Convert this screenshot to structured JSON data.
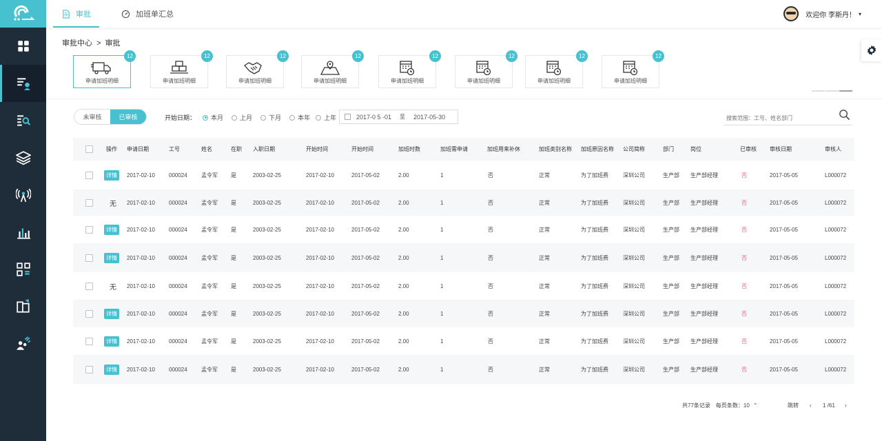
{
  "topbar": {
    "tabs": [
      {
        "label": "审批",
        "icon": "document-icon",
        "active": true
      },
      {
        "label": "加班单汇总",
        "icon": "dashboard-icon",
        "active": false
      }
    ],
    "user_greeting": "欢迎你  李斯丹！",
    "user_caret": "▾"
  },
  "sidebar": {
    "items": [
      {
        "icon": "grid-icon",
        "active": false
      },
      {
        "icon": "approval-list-icon",
        "active": true
      },
      {
        "icon": "search-list-icon",
        "active": false
      },
      {
        "icon": "layers-icon",
        "active": false
      },
      {
        "icon": "broadcast-icon",
        "active": false
      },
      {
        "icon": "bar-chart-icon",
        "active": false
      },
      {
        "icon": "qr-code-icon",
        "active": false
      },
      {
        "icon": "book-icon",
        "active": false
      },
      {
        "icon": "team-growth-icon",
        "active": false
      }
    ]
  },
  "breadcrumb": {
    "root": "审批中心",
    "sep": ">",
    "current": "审批"
  },
  "cards": [
    {
      "label": "申请加班明细",
      "badge": "12",
      "icon": "truck-icon",
      "active": true
    },
    {
      "label": "申请加班明细",
      "badge": "12",
      "icon": "cargo-icon",
      "active": false
    },
    {
      "label": "申请加班明细",
      "badge": "12",
      "icon": "handshake-icon",
      "active": false
    },
    {
      "label": "申请加班明细",
      "badge": "12",
      "icon": "map-pin-icon",
      "active": false
    },
    {
      "label": "申请加班明细",
      "badge": "12",
      "icon": "calendar-clock-icon",
      "active": false
    },
    {
      "label": "申请加班明细",
      "badge": "12",
      "icon": "calendar-clock-icon",
      "active": false
    },
    {
      "label": "申请加班明细",
      "badge": "12",
      "icon": "calendar-clock-icon",
      "active": false
    },
    {
      "label": "申请加班明细",
      "badge": "12",
      "icon": "calendar-clock-icon",
      "active": false
    }
  ],
  "filter": {
    "status_tabs": [
      {
        "label": "未审核",
        "active": false
      },
      {
        "label": "已审核",
        "active": true
      }
    ],
    "date_label": "开始日期：",
    "radios": [
      {
        "label": "本月",
        "checked": true
      },
      {
        "label": "上月",
        "checked": false
      },
      {
        "label": "下月",
        "checked": false
      },
      {
        "label": "本年",
        "checked": false
      },
      {
        "label": "上年",
        "checked": false
      }
    ],
    "range_start": "2017-0 5 -01",
    "range_to": "至",
    "range_end": "2017-05-30",
    "search_placeholder": "搜索范围：工号、姓名部门"
  },
  "table": {
    "columns": [
      "",
      "操作",
      "申请日期",
      "工号",
      "姓名",
      "在职",
      "入职日期",
      "开始时间",
      "开始时间",
      "加班时数",
      "加班需申请",
      "加班用来补休",
      "加班类别名称",
      "加班原因名称",
      "公司简称",
      "部门",
      "岗位",
      "已审核",
      "审核日期",
      "审核人"
    ],
    "rows": [
      {
        "op": "详情",
        "apply_date": "2017-02-10",
        "emp_no": "000024",
        "name": "孟令军",
        "employed": "是",
        "hire_date": "2003-02-25",
        "start1": "2017-02-10",
        "start2": "2017-05-02",
        "hours": "2.00",
        "need_apply": "1",
        "comp_leave": "否",
        "category": "正常",
        "reason": "为了加班费",
        "company": "深圳公司",
        "dept": "生产部",
        "post": "生产部经理",
        "reviewed": "否",
        "review_date": "2017-05-05",
        "reviewer": "L000072"
      },
      {
        "op": "无",
        "apply_date": "2017-02-10",
        "emp_no": "000024",
        "name": "孟令军",
        "employed": "是",
        "hire_date": "2003-02-25",
        "start1": "2017-02-10",
        "start2": "2017-05-02",
        "hours": "2.00",
        "need_apply": "1",
        "comp_leave": "否",
        "category": "正常",
        "reason": "为了加班费",
        "company": "深圳公司",
        "dept": "生产部",
        "post": "生产部经理",
        "reviewed": "否",
        "review_date": "2017-05-05",
        "reviewer": "L000072"
      },
      {
        "op": "详情",
        "apply_date": "2017-02-10",
        "emp_no": "000024",
        "name": "孟令军",
        "employed": "是",
        "hire_date": "2003-02-25",
        "start1": "2017-02-10",
        "start2": "2017-05-02",
        "hours": "2.00",
        "need_apply": "1",
        "comp_leave": "否",
        "category": "正常",
        "reason": "为了加班费",
        "company": "深圳公司",
        "dept": "生产部",
        "post": "生产部经理",
        "reviewed": "否",
        "review_date": "2017-05-05",
        "reviewer": "L000072"
      },
      {
        "op": "详情",
        "apply_date": "2017-02-10",
        "emp_no": "000024",
        "name": "孟令军",
        "employed": "是",
        "hire_date": "2003-02-25",
        "start1": "2017-02-10",
        "start2": "2017-05-02",
        "hours": "2.00",
        "need_apply": "1",
        "comp_leave": "否",
        "category": "正常",
        "reason": "为了加班费",
        "company": "深圳公司",
        "dept": "生产部",
        "post": "生产部经理",
        "reviewed": "否",
        "review_date": "2017-05-05",
        "reviewer": "L000072"
      },
      {
        "op": "无",
        "apply_date": "2017-02-10",
        "emp_no": "000024",
        "name": "孟令军",
        "employed": "是",
        "hire_date": "2003-02-25",
        "start1": "2017-02-10",
        "start2": "2017-05-02",
        "hours": "2.00",
        "need_apply": "1",
        "comp_leave": "否",
        "category": "正常",
        "reason": "为了加班费",
        "company": "深圳公司",
        "dept": "生产部",
        "post": "生产部经理",
        "reviewed": "否",
        "review_date": "2017-05-05",
        "reviewer": "L000072"
      },
      {
        "op": "详情",
        "apply_date": "2017-02-10",
        "emp_no": "000024",
        "name": "孟令军",
        "employed": "是",
        "hire_date": "2003-02-25",
        "start1": "2017-02-10",
        "start2": "2017-05-02",
        "hours": "2.00",
        "need_apply": "1",
        "comp_leave": "否",
        "category": "正常",
        "reason": "为了加班费",
        "company": "深圳公司",
        "dept": "生产部",
        "post": "生产部经理",
        "reviewed": "否",
        "review_date": "2017-05-05",
        "reviewer": "L000072"
      },
      {
        "op": "详情",
        "apply_date": "2017-02-10",
        "emp_no": "000024",
        "name": "孟令军",
        "employed": "是",
        "hire_date": "2003-02-25",
        "start1": "2017-02-10",
        "start2": "2017-05-02",
        "hours": "2.00",
        "need_apply": "1",
        "comp_leave": "否",
        "category": "正常",
        "reason": "为了加班费",
        "company": "深圳公司",
        "dept": "生产部",
        "post": "生产部经理",
        "reviewed": "否",
        "review_date": "2017-05-05",
        "reviewer": "L000072"
      },
      {
        "op": "详情",
        "apply_date": "2017-02-10",
        "emp_no": "000024",
        "name": "孟令军",
        "employed": "是",
        "hire_date": "2003-02-25",
        "start1": "2017-02-10",
        "start2": "2017-05-02",
        "hours": "2.00",
        "need_apply": "1",
        "comp_leave": "否",
        "category": "正常",
        "reason": "为了加班费",
        "company": "深圳公司",
        "dept": "生产部",
        "post": "生产部经理",
        "reviewed": "否",
        "review_date": "2017-05-05",
        "reviewer": "L000072"
      }
    ]
  },
  "pagination": {
    "total": "共77条记录",
    "per_page_label": "每页条数：",
    "per_page": "10",
    "per_page_caret": "⌃",
    "jump_label": "跳转",
    "prev": "‹",
    "page_info": "1 /61",
    "next": "›"
  },
  "colors": {
    "accent": "#47c1cf",
    "sidebar": "#1f2c3a",
    "alert": "#e8677f"
  }
}
